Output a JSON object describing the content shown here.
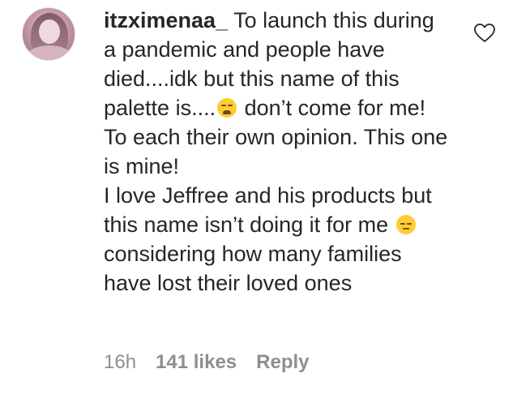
{
  "comment": {
    "username": "itzximenaa_",
    "text_part1": " To launch this during a pandemic and people have died....idk but this name of this palette is....",
    "emoji1": "tired-face",
    "text_part2": "  don’t come for me! To each their own opinion. This one is mine!",
    "text_part3": "I love Jeffree and his products but this name isn’t doing it for me ",
    "emoji2": "pensive-face",
    "text_part4": "  considering how many families have lost their loved ones",
    "time": "16h",
    "likes": "141 likes",
    "reply_label": "Reply"
  },
  "colors": {
    "text": "#262626",
    "meta": "#8e8e8e"
  }
}
